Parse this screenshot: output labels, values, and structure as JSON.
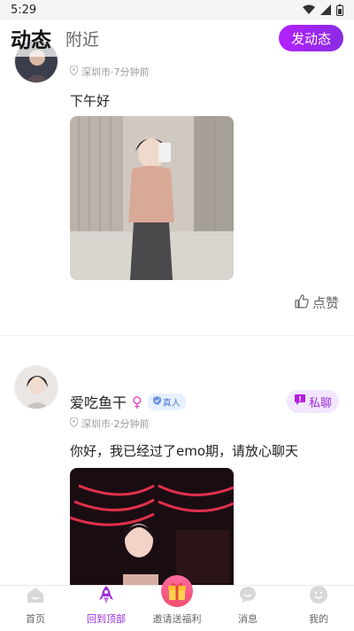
{
  "status_bar": {
    "time": "5:29"
  },
  "header": {
    "tab_active": "动态",
    "tab_inactive": "附近",
    "post_button": "发动态"
  },
  "posts": [
    {
      "location": "深圳市·7分钟前",
      "text": "下午好",
      "like_label": "点赞"
    },
    {
      "username": "爱吃鱼干",
      "gender_symbol": "♀",
      "verified_label": "真人",
      "chat_label": "私聊",
      "location": "深圳市·2分钟前",
      "text": "你好，我已经过了emo期，请放心聊天"
    }
  ],
  "bottom_nav": [
    {
      "label": "首页",
      "icon": "home-icon"
    },
    {
      "label": "回到顶部",
      "icon": "rocket-icon"
    },
    {
      "label": "邀请送福利",
      "icon": "gift-icon"
    },
    {
      "label": "消息",
      "icon": "message-icon"
    },
    {
      "label": "我的",
      "icon": "profile-icon"
    }
  ],
  "colors": {
    "accent": "#9a2dd6",
    "post_button": "#b421ff",
    "gender": "#e040c8",
    "verified": "#4a7bd8"
  }
}
